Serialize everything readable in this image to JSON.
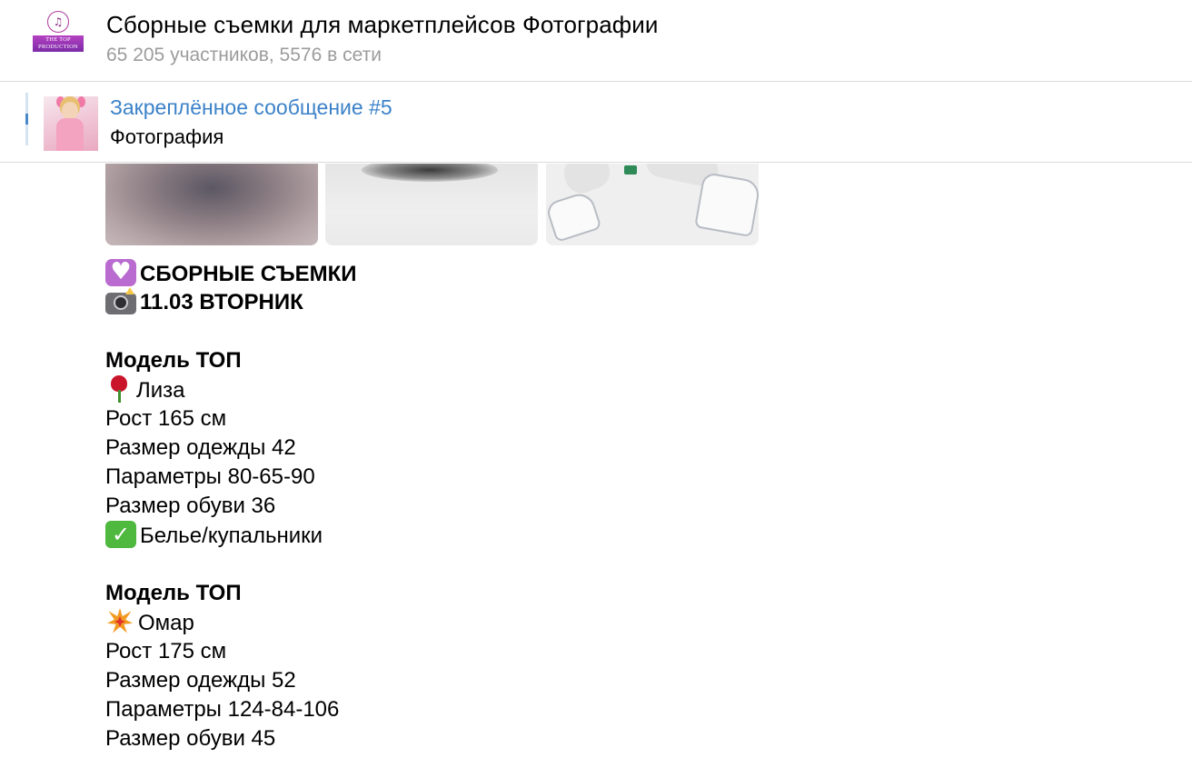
{
  "header": {
    "logo": {
      "icon": "music-note-logo-icon",
      "mark": "♫",
      "line1": "THE TOP",
      "line2": "PRODUCTION"
    },
    "title": "Сборные съемки для маркетплейсов Фотографии",
    "subtitle": "65 205 участников, 5576 в сети"
  },
  "pinned": {
    "title": "Закреплённое сообщение #5",
    "text": "Фотография",
    "accent_color": "#3c82c8"
  },
  "message": {
    "lines": [
      {
        "icon": "purple-heart-icon",
        "text": "СБОРНЫЕ СЪЕМКИ",
        "bold": true
      },
      {
        "icon": "camera-flash-icon",
        "text": "11.03 ВТОРНИК",
        "bold": true
      },
      {
        "text": ""
      },
      {
        "text": "Модель ТОП",
        "bold": true
      },
      {
        "icon": "rose-icon",
        "text": "Лиза"
      },
      {
        "text": "Рост 165 см"
      },
      {
        "text": "Размер одежды 42"
      },
      {
        "text": "Параметры 80-65-90"
      },
      {
        "text": "Размер обуви 36"
      },
      {
        "icon": "check-mark-icon",
        "text": "Белье/купальники"
      },
      {
        "text": ""
      },
      {
        "text": "Модель ТОП",
        "bold": true
      },
      {
        "icon": "collision-icon",
        "text": "Омар"
      },
      {
        "text": "Рост 175 см"
      },
      {
        "text": "Размер одежды 52"
      },
      {
        "text": "Параметры 124-84-106"
      },
      {
        "text": "Размер обуви 45"
      }
    ]
  }
}
